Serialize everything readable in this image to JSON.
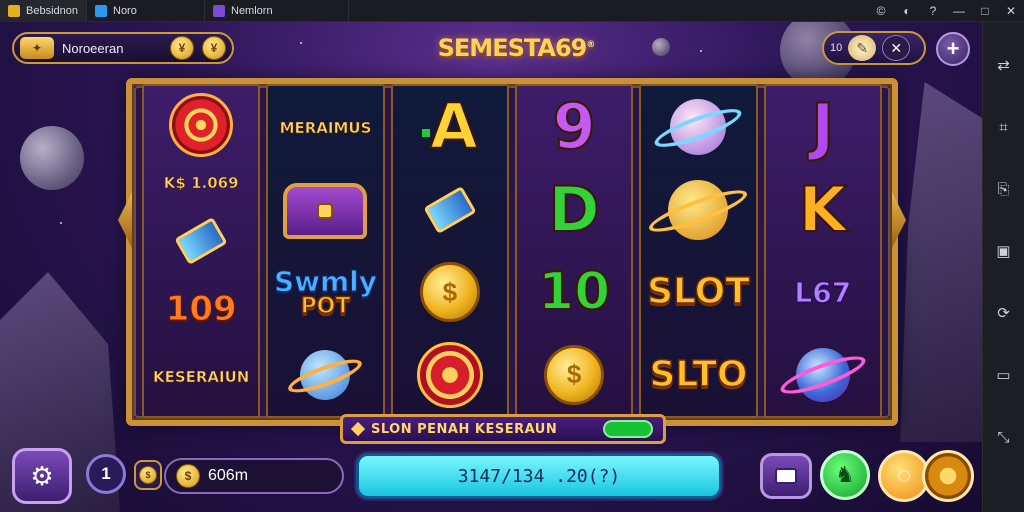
{
  "emulator": {
    "tabs": [
      {
        "label": "Bebsidnon",
        "color": "#e8b020"
      },
      {
        "label": "Noro",
        "color": "#2a9af0"
      },
      {
        "label": "Nemlorn",
        "color": "#7a4ad8"
      }
    ],
    "window_buttons": [
      "?",
      "?",
      "?",
      "—",
      "□",
      "✕"
    ],
    "sidebar_icons": [
      "expand-icon",
      "screenshot-icon",
      "import-icon",
      "apk-icon",
      "rotate-icon",
      "folder-icon",
      "shake-icon"
    ]
  },
  "hud": {
    "player_name": "Noroeeran",
    "gold_icon": "✦",
    "coin_1": "¥",
    "coin_2": "¥",
    "right_value": "10",
    "feather_icon": "✎",
    "close_icon": "✕",
    "plus_icon": "+"
  },
  "logo": {
    "title": "SEMESTA69",
    "mark": "®"
  },
  "reels": [
    {
      "symbols": [
        {
          "kind": "spiral"
        },
        {
          "kind": "label",
          "text": "K$ 1.069"
        },
        {
          "kind": "gem"
        },
        {
          "kind": "number",
          "text": "109"
        },
        {
          "kind": "label",
          "text": "KESERAIUN"
        }
      ]
    },
    {
      "symbols": [
        {
          "kind": "label",
          "text": "MERAIMUS"
        },
        {
          "kind": "chest"
        },
        {
          "kind": "word",
          "text": "Swmly"
        },
        {
          "kind": "word-sub",
          "text": "POT"
        },
        {
          "kind": "planet"
        }
      ]
    },
    {
      "symbols": [
        {
          "kind": "letter",
          "text": "A",
          "color": "#ffd23a"
        },
        {
          "kind": "gem"
        },
        {
          "kind": "coin"
        },
        {
          "kind": "target"
        }
      ]
    },
    {
      "symbols": [
        {
          "kind": "letter",
          "text": "9",
          "color": "#c45af0"
        },
        {
          "kind": "letter",
          "text": "D",
          "color": "#34d23a"
        },
        {
          "kind": "letter",
          "text": "10",
          "color": "#34d23a"
        },
        {
          "kind": "coin"
        }
      ]
    },
    {
      "symbols": [
        {
          "kind": "planet"
        },
        {
          "kind": "planet-gold"
        },
        {
          "kind": "word",
          "text": "SLOT"
        },
        {
          "kind": "word",
          "text": "SLTO"
        }
      ]
    },
    {
      "symbols": [
        {
          "kind": "letter",
          "text": "J",
          "color": "#b04af0"
        },
        {
          "kind": "letter",
          "text": "K",
          "color": "#ffb020"
        },
        {
          "kind": "number",
          "text": "L67"
        },
        {
          "kind": "planet-pink"
        }
      ]
    }
  ],
  "banner": {
    "text": "SLON PENAH KESERAUN"
  },
  "controls": {
    "settings_icon": "⚙",
    "level": "1",
    "balance": "606m",
    "bet_display": "3147/134 .20(?)",
    "auto_icon": "♞",
    "spin_icon": "◌"
  },
  "colors": {
    "frame_gold": "#c9913a",
    "bet_cyan": "#18c6e0",
    "highlight_green": "#2ac63a"
  }
}
